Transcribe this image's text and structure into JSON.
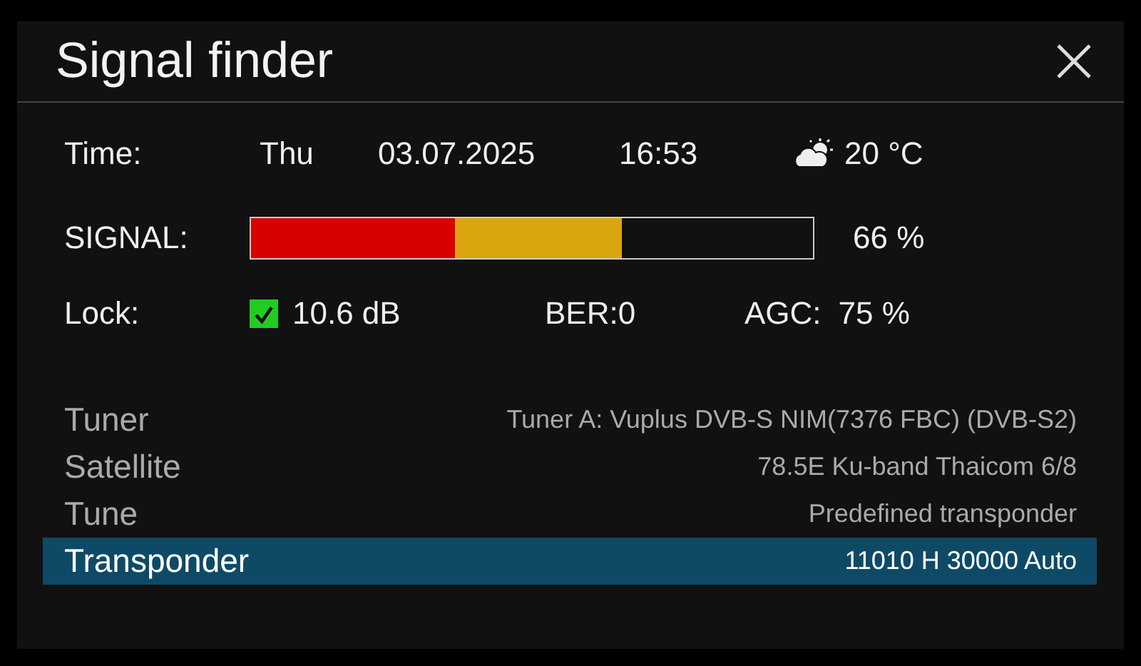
{
  "window": {
    "title": "Signal finder"
  },
  "time": {
    "label": "Time:",
    "day": "Thu",
    "date": "03.07.2025",
    "clock": "16:53",
    "temperature": "20 °C"
  },
  "signal": {
    "label": "SIGNAL:",
    "level": 0.66,
    "reading": "66 %"
  },
  "lock": {
    "label": "Lock:",
    "checked": true,
    "snr": "10.6 dB",
    "ber": "BER:0",
    "agc_label": "AGC:",
    "agc": "75 %"
  },
  "settings": [
    {
      "label": "Tuner",
      "value": "Tuner A: Vuplus DVB-S NIM(7376 FBC) (DVB-S2)",
      "selected": false
    },
    {
      "label": "Satellite",
      "value": "78.5E Ku-band Thaicom 6/8",
      "selected": false
    },
    {
      "label": "Tune",
      "value": "Predefined transponder",
      "selected": false
    },
    {
      "label": "Transponder",
      "value": "11010 H 30000 Auto",
      "selected": true
    }
  ]
}
